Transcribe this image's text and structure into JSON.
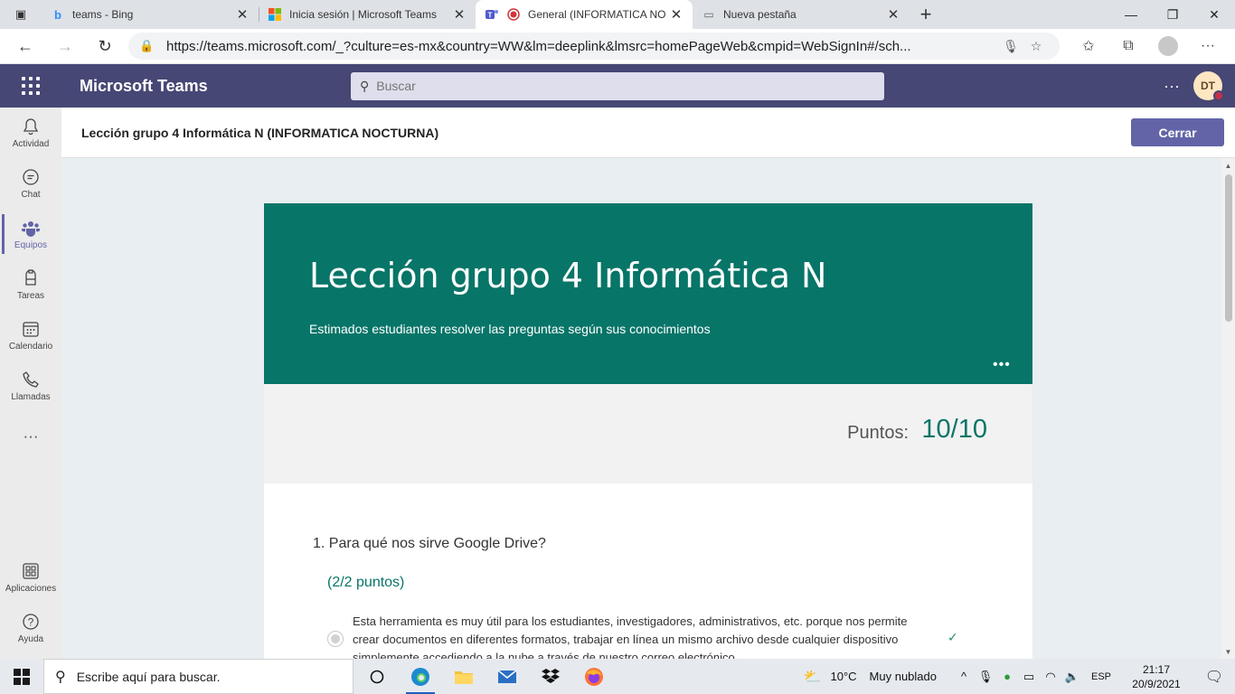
{
  "browser": {
    "tabs": [
      {
        "title": "teams - Bing",
        "active": false
      },
      {
        "title": "Inicia sesión | Microsoft Teams",
        "active": false
      },
      {
        "title": "General (INFORMATICA NO",
        "active": true
      },
      {
        "title": "Nueva pestaña",
        "active": false
      }
    ],
    "url": "https://teams.microsoft.com/_?culture=es-mx&country=WW&lm=deeplink&lmsrc=homePageWeb&cmpid=WebSignIn#/sch..."
  },
  "teams": {
    "app_name": "Microsoft Teams",
    "search_placeholder": "Buscar",
    "avatar_initials": "DT",
    "more_label": "···"
  },
  "rail": {
    "items": [
      {
        "label": "Actividad",
        "icon": "bell-icon",
        "glyph": "🔔"
      },
      {
        "label": "Chat",
        "icon": "chat-icon",
        "glyph": "💬"
      },
      {
        "label": "Equipos",
        "icon": "teams-icon",
        "glyph": "👥"
      },
      {
        "label": "Tareas",
        "icon": "assignments-icon",
        "glyph": "🎒"
      },
      {
        "label": "Calendario",
        "icon": "calendar-icon",
        "glyph": "📅"
      },
      {
        "label": "Llamadas",
        "icon": "phone-icon",
        "glyph": "📞"
      }
    ],
    "more": "···",
    "bottom_items": [
      {
        "label": "Aplicaciones",
        "icon": "apps-icon",
        "glyph": "⊞"
      },
      {
        "label": "Ayuda",
        "icon": "help-icon",
        "glyph": "?"
      }
    ]
  },
  "content": {
    "header_title": "Lección grupo 4 Informática N (INFORMATICA NOCTURNA)",
    "close_label": "Cerrar"
  },
  "form": {
    "title": "Lección grupo 4 Informática N",
    "description": "Estimados estudiantes resolver las preguntas según sus conocimientos",
    "points_label": "Puntos:",
    "points_value": "10/10",
    "question": "1. Para qué nos sirve Google Drive?",
    "question_points": "(2/2 puntos)",
    "option_text": "Esta herramienta es muy útil para los estudiantes, investigadores, administrativos, etc. porque nos permite crear documentos en diferentes formatos, trabajar en línea un mismo archivo desde cualquier dispositivo simplemente accediendo a la nube a través de nuestro correo electrónico",
    "option_correct": true
  },
  "taskbar": {
    "search_placeholder": "Escribe aquí para buscar.",
    "weather_temp": "10°C",
    "weather_desc": "Muy nublado",
    "language": "ESP",
    "time": "21:17",
    "date": "20/9/2021"
  },
  "colors": {
    "teams_purple": "#464775",
    "accent": "#6264a7",
    "form_teal": "#077568"
  }
}
